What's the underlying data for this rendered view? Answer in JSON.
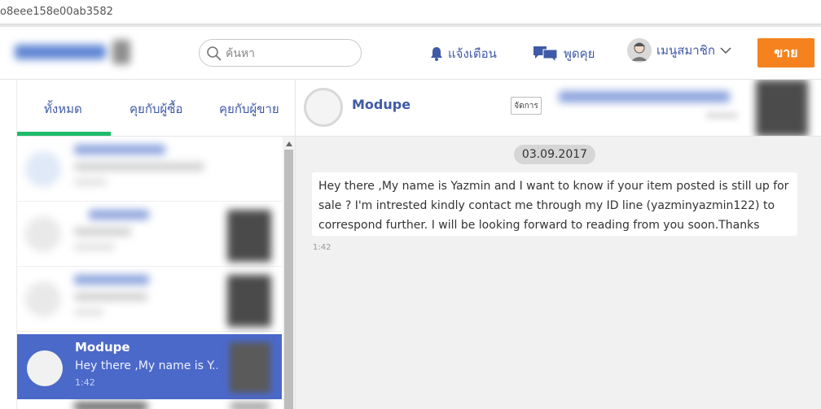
{
  "browser": {
    "url": "o8eee158e00ab3582"
  },
  "header": {
    "search_placeholder": "ค้นหา",
    "notifications_label": "แจ้งเตือน",
    "chat_label": "พูดคุย",
    "member_label": "เมนูสมาชิก",
    "sell_label": "ขาย",
    "accent_color": "#3f5aa6",
    "sell_color": "#f5821f"
  },
  "tabs": [
    {
      "label": "ทั้งหมด",
      "active": true
    },
    {
      "label": "คุยกับผู้ซื้อ",
      "active": false
    },
    {
      "label": "คุยกับผู้ขาย",
      "active": false
    }
  ],
  "active_conversation": {
    "name": "Modupe",
    "preview": "Hey there ,My name is Y...",
    "time": "1:42",
    "highlight_color": "#4b69c9"
  },
  "chat": {
    "contact_name": "Modupe",
    "manage_label": "จัดการ",
    "date": "03.09.2017",
    "messages": [
      {
        "text": "Hey there ,My name is Yazmin and I want to know if your item posted is still up for sale ? I'm intrested kindly contact me through my ID line (yazminyazmin122) to correspond further. I will be looking forward to reading from you soon.Thanks",
        "time": "1:42"
      }
    ]
  }
}
